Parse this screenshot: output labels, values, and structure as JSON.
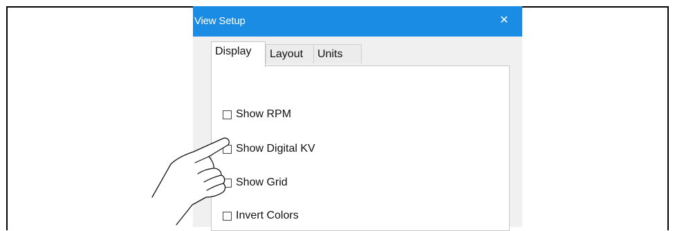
{
  "dialog": {
    "title": "View Setup",
    "close_label": "✕"
  },
  "tabs": [
    {
      "label": "Display",
      "active": true
    },
    {
      "label": "Layout",
      "active": false
    },
    {
      "label": "Units",
      "active": false
    }
  ],
  "options": [
    {
      "label": "Show RPM",
      "checked": false
    },
    {
      "label": "Show Digital KV",
      "checked": false
    },
    {
      "label": "Show Grid",
      "checked": false
    },
    {
      "label": "Invert Colors",
      "checked": false
    }
  ],
  "colors": {
    "titlebar": "#1a8ce3",
    "dialog_bg": "#f0f0f0",
    "panel_bg": "#ffffff"
  },
  "illustration": {
    "pointer": "pointing-hand-icon"
  }
}
